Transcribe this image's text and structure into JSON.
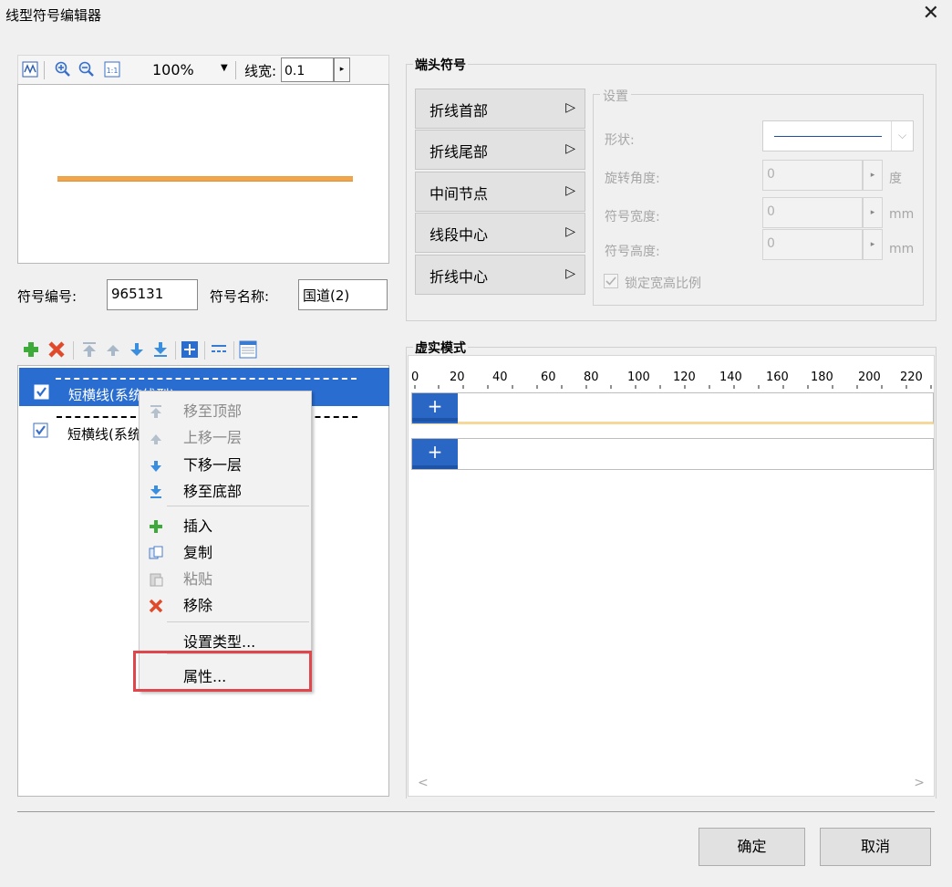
{
  "window": {
    "title": "线型符号编辑器",
    "close": "✕"
  },
  "preview_toolbar": {
    "zoom": "100%",
    "zoom_dropdown": "▼",
    "line_width_label": "线宽:",
    "line_width_value": "0.1",
    "spin_arrow": "▸"
  },
  "symbol_fields": {
    "id_label": "符号编号:",
    "id_value": "965131",
    "name_label": "符号名称:",
    "name_value": "国道(2)"
  },
  "end_symbols": {
    "group_title": "端头符号",
    "buttons": [
      {
        "label": "折线首部",
        "arrow": "▷"
      },
      {
        "label": "折线尾部",
        "arrow": "▷"
      },
      {
        "label": "中间节点",
        "arrow": "▷"
      },
      {
        "label": "线段中心",
        "arrow": "▷"
      },
      {
        "label": "折线中心",
        "arrow": "▷"
      }
    ],
    "settings": {
      "title": "设置",
      "shape_label": "形状:",
      "rotation_label": "旋转角度:",
      "rotation_value": "0",
      "rotation_unit": "度",
      "width_label": "符号宽度:",
      "width_value": "0",
      "width_unit": "mm",
      "height_label": "符号高度:",
      "height_value": "0",
      "height_unit": "mm",
      "lock_label": "锁定宽高比例",
      "spin": "▸",
      "dropdown": "⌵"
    }
  },
  "layers": {
    "items": [
      {
        "label": "短横线(系统线型)",
        "checked": true,
        "selected": true
      },
      {
        "label": "短横线(系统线型)",
        "checked": true,
        "selected": false
      }
    ]
  },
  "dash_mode": {
    "group_title": "虚实模式",
    "ticks": [
      "0",
      "20",
      "40",
      "60",
      "80",
      "100",
      "120",
      "140",
      "160",
      "180",
      "200",
      "220"
    ],
    "track_plus": "+",
    "scroll_left": "<",
    "scroll_right": ">"
  },
  "context_menu": {
    "items": [
      {
        "label": "移至顶部",
        "enabled": false
      },
      {
        "label": "上移一层",
        "enabled": false
      },
      {
        "label": "下移一层",
        "enabled": true
      },
      {
        "label": "移至底部",
        "enabled": true
      },
      {
        "label": "插入",
        "enabled": true
      },
      {
        "label": "复制",
        "enabled": true
      },
      {
        "label": "粘贴",
        "enabled": false
      },
      {
        "label": "移除",
        "enabled": true
      },
      {
        "label": "设置类型...",
        "enabled": true
      },
      {
        "label": "属性...",
        "enabled": true
      }
    ]
  },
  "footer": {
    "ok": "确定",
    "cancel": "取消"
  },
  "colors": {
    "selection": "#2a6dd0",
    "line_preview": "#f2a54a",
    "highlight": "#e0474c",
    "accent_blue": "#2a66c4"
  }
}
